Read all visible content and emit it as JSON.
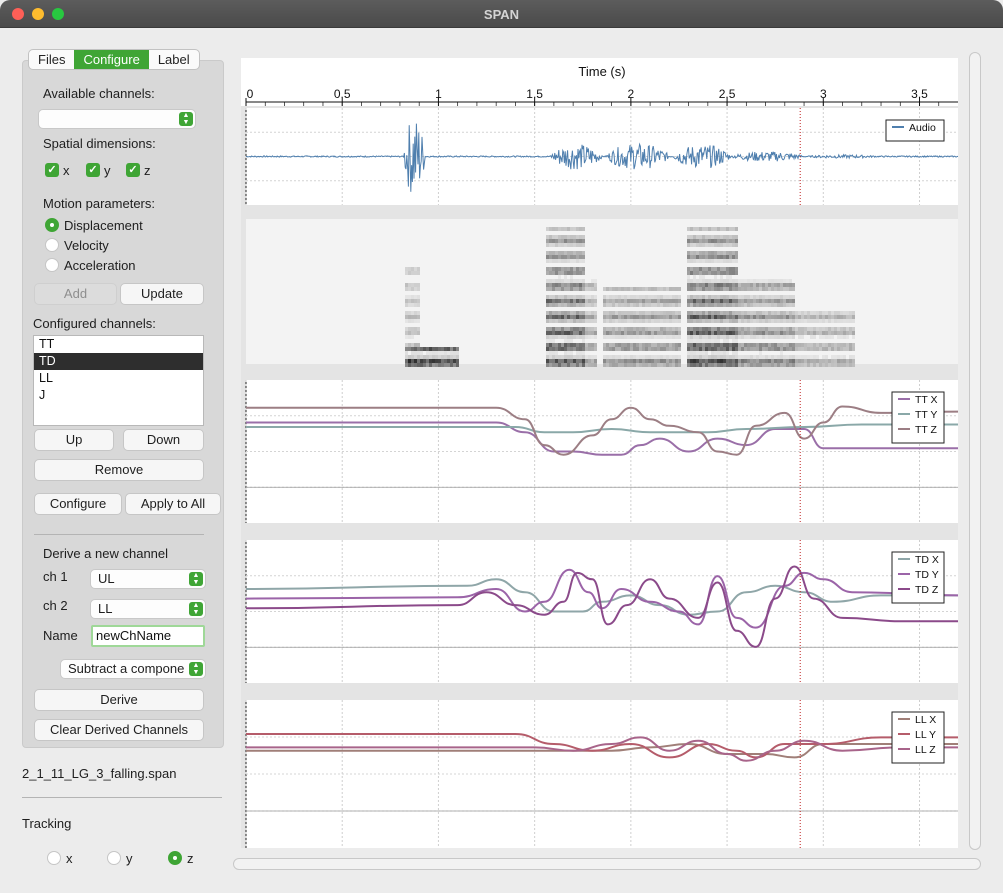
{
  "window": {
    "title": "SPAN"
  },
  "tabs": [
    {
      "label": "Files",
      "active": false
    },
    {
      "label": "Configure",
      "active": true
    },
    {
      "label": "Label",
      "active": false
    }
  ],
  "configure": {
    "available_channels_label": "Available channels:",
    "available_channels_value": "",
    "spatial_dimensions_label": "Spatial dimensions:",
    "dimensions": [
      {
        "label": "x",
        "checked": true
      },
      {
        "label": "y",
        "checked": true
      },
      {
        "label": "z",
        "checked": true
      }
    ],
    "motion_parameters_label": "Motion parameters:",
    "motion_parameters": [
      {
        "label": "Displacement",
        "selected": true
      },
      {
        "label": "Velocity",
        "selected": false
      },
      {
        "label": "Acceleration",
        "selected": false
      }
    ],
    "add_label": "Add",
    "update_label": "Update",
    "configured_channels_label": "Configured channels:",
    "configured_channels": [
      "TT",
      "TD",
      "LL",
      "J"
    ],
    "selected_channel": "TD",
    "up_label": "Up",
    "down_label": "Down",
    "remove_label": "Remove",
    "configure_label": "Configure",
    "apply_all_label": "Apply to All"
  },
  "derive": {
    "title": "Derive a new channel",
    "ch1_label": "ch 1",
    "ch1_value": "UL",
    "ch2_label": "ch 2",
    "ch2_value": "LL",
    "name_label": "Name",
    "name_value": "newChName",
    "operation_value": "Subtract a compone",
    "derive_label": "Derive",
    "clear_label": "Clear Derived Channels"
  },
  "filename": "2_1_11_LG_3_falling.span",
  "tracking": {
    "label": "Tracking",
    "options": [
      {
        "label": "x",
        "selected": false
      },
      {
        "label": "y",
        "selected": false
      },
      {
        "label": "z",
        "selected": true
      }
    ]
  },
  "colors": {
    "accent": "#3fa535",
    "audio": "#4f7fae",
    "x_series": "#9b7a8a",
    "cursor": "#c02020"
  },
  "chart_data": [
    {
      "type": "line",
      "panel": "audio",
      "xlabel": "Time (s)",
      "xlim": [
        0,
        3.7
      ],
      "xticks": [
        "0",
        "0.5",
        "1",
        "1.5",
        "2",
        "2.5",
        "3",
        "3.5"
      ],
      "cursor_time": 2.88,
      "grid": true,
      "legend": "top-right",
      "series": [
        {
          "name": "Audio",
          "color": "#4f7fae"
        }
      ],
      "segments": [
        {
          "start": 0.82,
          "end": 0.93,
          "amp": 0.95
        },
        {
          "start": 1.58,
          "end": 1.85,
          "amp": 0.3
        },
        {
          "start": 1.87,
          "end": 2.2,
          "amp": 0.3
        },
        {
          "start": 2.22,
          "end": 2.52,
          "amp": 0.28
        },
        {
          "start": 2.52,
          "end": 2.9,
          "amp": 0.12
        },
        {
          "start": 2.9,
          "end": 3.3,
          "amp": 0.04
        }
      ]
    },
    {
      "type": "heatmap",
      "panel": "spectrogram",
      "xlim": [
        0,
        3.7
      ],
      "bursts": [
        {
          "start": 0.82,
          "end": 0.9,
          "low": 0.0,
          "high": 0.75,
          "strength": 0.35
        },
        {
          "start": 0.82,
          "end": 1.1,
          "low": 0.0,
          "high": 0.12,
          "strength": 0.95
        },
        {
          "start": 1.55,
          "end": 1.75,
          "low": 0.0,
          "high": 0.95,
          "strength": 0.85
        },
        {
          "start": 1.75,
          "end": 1.82,
          "low": 0.0,
          "high": 0.6,
          "strength": 0.45
        },
        {
          "start": 1.85,
          "end": 2.25,
          "low": 0.0,
          "high": 0.55,
          "strength": 0.55
        },
        {
          "start": 2.28,
          "end": 2.55,
          "low": 0.0,
          "high": 0.95,
          "strength": 0.9
        },
        {
          "start": 2.55,
          "end": 2.85,
          "low": 0.0,
          "high": 0.6,
          "strength": 0.6
        },
        {
          "start": 2.85,
          "end": 3.15,
          "low": 0.0,
          "high": 0.4,
          "strength": 0.4
        }
      ]
    },
    {
      "type": "line",
      "panel": "TT",
      "xlim": [
        0,
        3.7
      ],
      "ylim": [
        -1,
        1
      ],
      "cursor_time": 2.88,
      "legend": "top-right",
      "series": [
        {
          "name": "TT X",
          "color": "#9a6fa8",
          "points": [
            [
              0,
              0.45
            ],
            [
              1.3,
              0.45
            ],
            [
              1.45,
              0.3
            ],
            [
              1.6,
              0.0
            ],
            [
              1.7,
              0.0
            ],
            [
              1.85,
              -0.05
            ],
            [
              1.95,
              -0.05
            ],
            [
              2.05,
              0.1
            ],
            [
              2.15,
              0.2
            ],
            [
              2.3,
              0.0
            ],
            [
              2.45,
              0.2
            ],
            [
              2.6,
              0.1
            ],
            [
              2.75,
              0.35
            ],
            [
              2.9,
              0.35
            ],
            [
              3.0,
              0.05
            ],
            [
              3.2,
              0.05
            ],
            [
              3.7,
              0.05
            ]
          ]
        },
        {
          "name": "TT Y",
          "color": "#8aa8a8",
          "points": [
            [
              0,
              0.38
            ],
            [
              1.4,
              0.38
            ],
            [
              1.55,
              0.3
            ],
            [
              1.7,
              0.3
            ],
            [
              1.9,
              0.35
            ],
            [
              2.1,
              0.3
            ],
            [
              2.4,
              0.3
            ],
            [
              2.6,
              0.35
            ],
            [
              2.9,
              0.38
            ],
            [
              3.2,
              0.42
            ],
            [
              3.7,
              0.42
            ]
          ]
        },
        {
          "name": "TT Z",
          "color": "#9c7e84",
          "points": [
            [
              0,
              0.68
            ],
            [
              1.3,
              0.68
            ],
            [
              1.45,
              0.5
            ],
            [
              1.55,
              0.1
            ],
            [
              1.65,
              -0.05
            ],
            [
              1.8,
              0.25
            ],
            [
              1.9,
              0.5
            ],
            [
              2.0,
              0.68
            ],
            [
              2.1,
              0.5
            ],
            [
              2.2,
              0.4
            ],
            [
              2.35,
              0.3
            ],
            [
              2.45,
              0.0
            ],
            [
              2.55,
              -0.05
            ],
            [
              2.65,
              0.4
            ],
            [
              2.8,
              0.6
            ],
            [
              2.9,
              0.2
            ],
            [
              3.0,
              0.45
            ],
            [
              3.1,
              0.7
            ],
            [
              3.3,
              0.6
            ],
            [
              3.7,
              0.62
            ]
          ]
        }
      ]
    },
    {
      "type": "line",
      "panel": "TD",
      "xlim": [
        0,
        3.7
      ],
      "ylim": [
        -1,
        1
      ],
      "cursor_time": 2.88,
      "legend": "top-right",
      "series": [
        {
          "name": "TD X",
          "color": "#8fa6a8",
          "points": [
            [
              0,
              0.35
            ],
            [
              1.15,
              0.4
            ],
            [
              1.3,
              0.5
            ],
            [
              1.45,
              0.3
            ],
            [
              1.6,
              0.0
            ],
            [
              1.75,
              0.0
            ],
            [
              1.85,
              0.15
            ],
            [
              2.0,
              0.25
            ],
            [
              2.15,
              0.1
            ],
            [
              2.3,
              -0.05
            ],
            [
              2.45,
              0.0
            ],
            [
              2.6,
              0.3
            ],
            [
              2.75,
              0.4
            ],
            [
              2.9,
              0.3
            ],
            [
              3.05,
              0.15
            ],
            [
              3.3,
              0.25
            ],
            [
              3.7,
              0.25
            ]
          ]
        },
        {
          "name": "TD Y",
          "color": "#9b64a8",
          "points": [
            [
              0,
              0.2
            ],
            [
              1.1,
              0.22
            ],
            [
              1.3,
              0.35
            ],
            [
              1.45,
              0.0
            ],
            [
              1.55,
              0.15
            ],
            [
              1.68,
              0.65
            ],
            [
              1.78,
              0.3
            ],
            [
              1.85,
              0.05
            ],
            [
              1.95,
              0.35
            ],
            [
              2.1,
              0.15
            ],
            [
              2.25,
              0.0
            ],
            [
              2.35,
              -0.2
            ],
            [
              2.45,
              0.55
            ],
            [
              2.55,
              -0.1
            ],
            [
              2.65,
              -0.25
            ],
            [
              2.8,
              0.4
            ],
            [
              2.9,
              0.6
            ],
            [
              3.0,
              0.5
            ],
            [
              3.15,
              0.3
            ],
            [
              3.7,
              0.25
            ]
          ]
        },
        {
          "name": "TD Z",
          "color": "#8b4a8a",
          "points": [
            [
              0,
              0.05
            ],
            [
              1.1,
              0.1
            ],
            [
              1.25,
              0.3
            ],
            [
              1.4,
              0.1
            ],
            [
              1.55,
              -0.05
            ],
            [
              1.65,
              0.15
            ],
            [
              1.72,
              0.6
            ],
            [
              1.8,
              0.5
            ],
            [
              1.88,
              -0.2
            ],
            [
              1.98,
              0.1
            ],
            [
              2.1,
              0.5
            ],
            [
              2.2,
              0.2
            ],
            [
              2.35,
              -0.1
            ],
            [
              2.45,
              0.45
            ],
            [
              2.55,
              -0.3
            ],
            [
              2.65,
              -0.55
            ],
            [
              2.75,
              0.2
            ],
            [
              2.85,
              0.7
            ],
            [
              2.95,
              0.2
            ],
            [
              3.1,
              -0.1
            ],
            [
              3.4,
              -0.15
            ],
            [
              3.7,
              -0.15
            ]
          ]
        }
      ]
    },
    {
      "type": "line",
      "panel": "LL",
      "xlim": [
        0,
        3.7
      ],
      "ylim": [
        -1,
        1
      ],
      "cursor_time": 2.88,
      "legend": "top-right",
      "series": [
        {
          "name": "LL X",
          "color": "#a07f78",
          "points": [
            [
              0,
              0.35
            ],
            [
              1.5,
              0.35
            ],
            [
              1.9,
              0.35
            ],
            [
              2.1,
              0.4
            ],
            [
              2.3,
              0.45
            ],
            [
              2.5,
              0.3
            ],
            [
              2.7,
              0.3
            ],
            [
              2.85,
              0.25
            ],
            [
              3.0,
              0.45
            ],
            [
              3.3,
              0.45
            ],
            [
              3.7,
              0.45
            ]
          ]
        },
        {
          "name": "LL Y",
          "color": "#b55c6a",
          "points": [
            [
              0,
              0.6
            ],
            [
              1.4,
              0.6
            ],
            [
              1.6,
              0.45
            ],
            [
              1.8,
              0.35
            ],
            [
              2.0,
              0.45
            ],
            [
              2.2,
              0.25
            ],
            [
              2.4,
              0.45
            ],
            [
              2.55,
              0.35
            ],
            [
              2.65,
              0.25
            ],
            [
              2.8,
              0.45
            ],
            [
              3.0,
              0.45
            ],
            [
              3.3,
              0.55
            ],
            [
              3.7,
              0.55
            ]
          ]
        },
        {
          "name": "LL Z",
          "color": "#a8648a",
          "points": [
            [
              0,
              0.4
            ],
            [
              1.5,
              0.4
            ],
            [
              1.7,
              0.35
            ],
            [
              1.9,
              0.45
            ],
            [
              2.05,
              0.55
            ],
            [
              2.2,
              0.35
            ],
            [
              2.35,
              0.5
            ],
            [
              2.5,
              0.3
            ],
            [
              2.6,
              0.2
            ],
            [
              2.75,
              0.35
            ],
            [
              2.9,
              0.5
            ],
            [
              3.1,
              0.35
            ],
            [
              3.4,
              0.4
            ],
            [
              3.7,
              0.4
            ]
          ]
        }
      ]
    }
  ]
}
